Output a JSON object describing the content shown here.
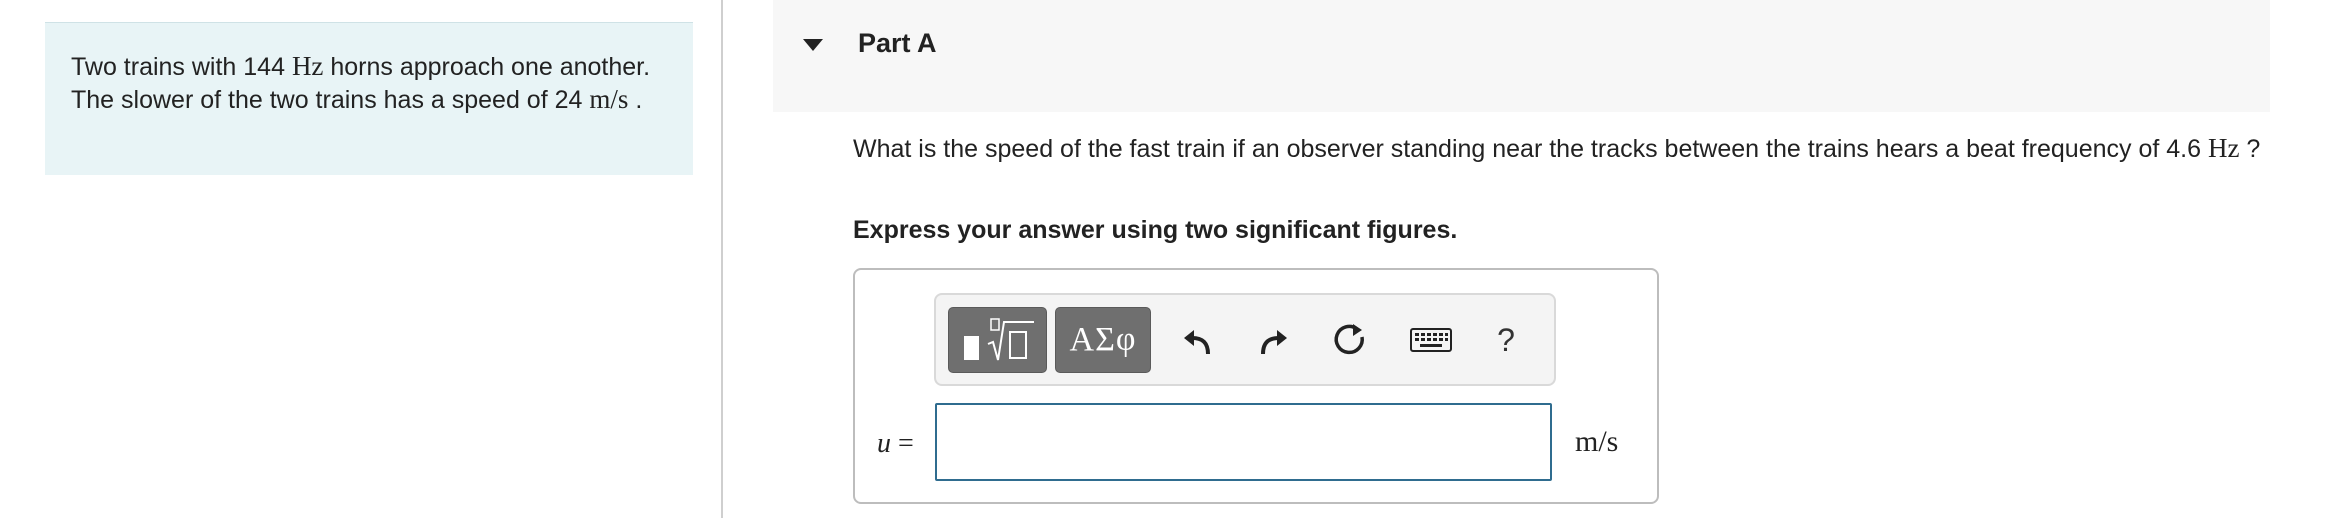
{
  "problem": {
    "text_before": "Two trains with 144 ",
    "unit_hz": "Hz",
    "text_middle": " horns approach one another. The slower of the two trains has a speed of 24 ",
    "unit_speed": "m/s",
    "text_after": " ."
  },
  "part": {
    "title": "Part A",
    "question_text": "What is the speed of the fast train if an observer standing near the tracks between the trains hears a beat frequency of 4.6 ",
    "question_unit": "Hz",
    "question_end": " ?",
    "instruction": "Express your answer using two significant figures."
  },
  "toolbar": {
    "greek_label": "ΑΣφ",
    "help_label": "?",
    "icons": [
      "templates-icon",
      "undo-icon",
      "redo-icon",
      "reset-icon",
      "keyboard-icon"
    ]
  },
  "answer": {
    "variable": "u",
    "equals": " =",
    "value": "",
    "unit": "m/s"
  },
  "colors": {
    "panel_bg": "#e8f4f6",
    "header_bg": "#f7f7f7",
    "input_border": "#2f6c8f",
    "tool_dark": "#6f6f6f"
  }
}
